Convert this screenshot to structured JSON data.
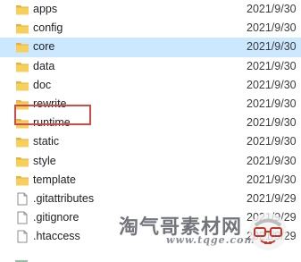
{
  "files": [
    {
      "name": "apps",
      "date": "2021/9/30",
      "type": "folder",
      "selected": false
    },
    {
      "name": "config",
      "date": "2021/9/30",
      "type": "folder",
      "selected": false
    },
    {
      "name": "core",
      "date": "2021/9/30",
      "type": "folder",
      "selected": true
    },
    {
      "name": "data",
      "date": "2021/9/30",
      "type": "folder",
      "selected": false
    },
    {
      "name": "doc",
      "date": "2021/9/30",
      "type": "folder",
      "selected": false
    },
    {
      "name": "rewrite",
      "date": "2021/9/30",
      "type": "folder",
      "selected": false,
      "highlighted": true
    },
    {
      "name": "runtime",
      "date": "2021/9/30",
      "type": "folder",
      "selected": false
    },
    {
      "name": "static",
      "date": "2021/9/30",
      "type": "folder",
      "selected": false
    },
    {
      "name": "style",
      "date": "2021/9/30",
      "type": "folder",
      "selected": false
    },
    {
      "name": "template",
      "date": "2021/9/30",
      "type": "folder",
      "selected": false
    },
    {
      "name": ".gitattributes",
      "date": "2021/9/29",
      "type": "file",
      "selected": false
    },
    {
      "name": ".gitignore",
      "date": "2021/9/29",
      "type": "file",
      "selected": false
    },
    {
      "name": ".htaccess",
      "date": "2021/9/29",
      "type": "file",
      "selected": false
    }
  ],
  "watermark": {
    "text": "淘气哥素材网",
    "url": "www.tqge.com"
  },
  "colors": {
    "folder": "#f6cf5c",
    "folder_dark": "#e9b23c",
    "selection": "#cce8ff",
    "highlight_border": "#d14a45"
  }
}
